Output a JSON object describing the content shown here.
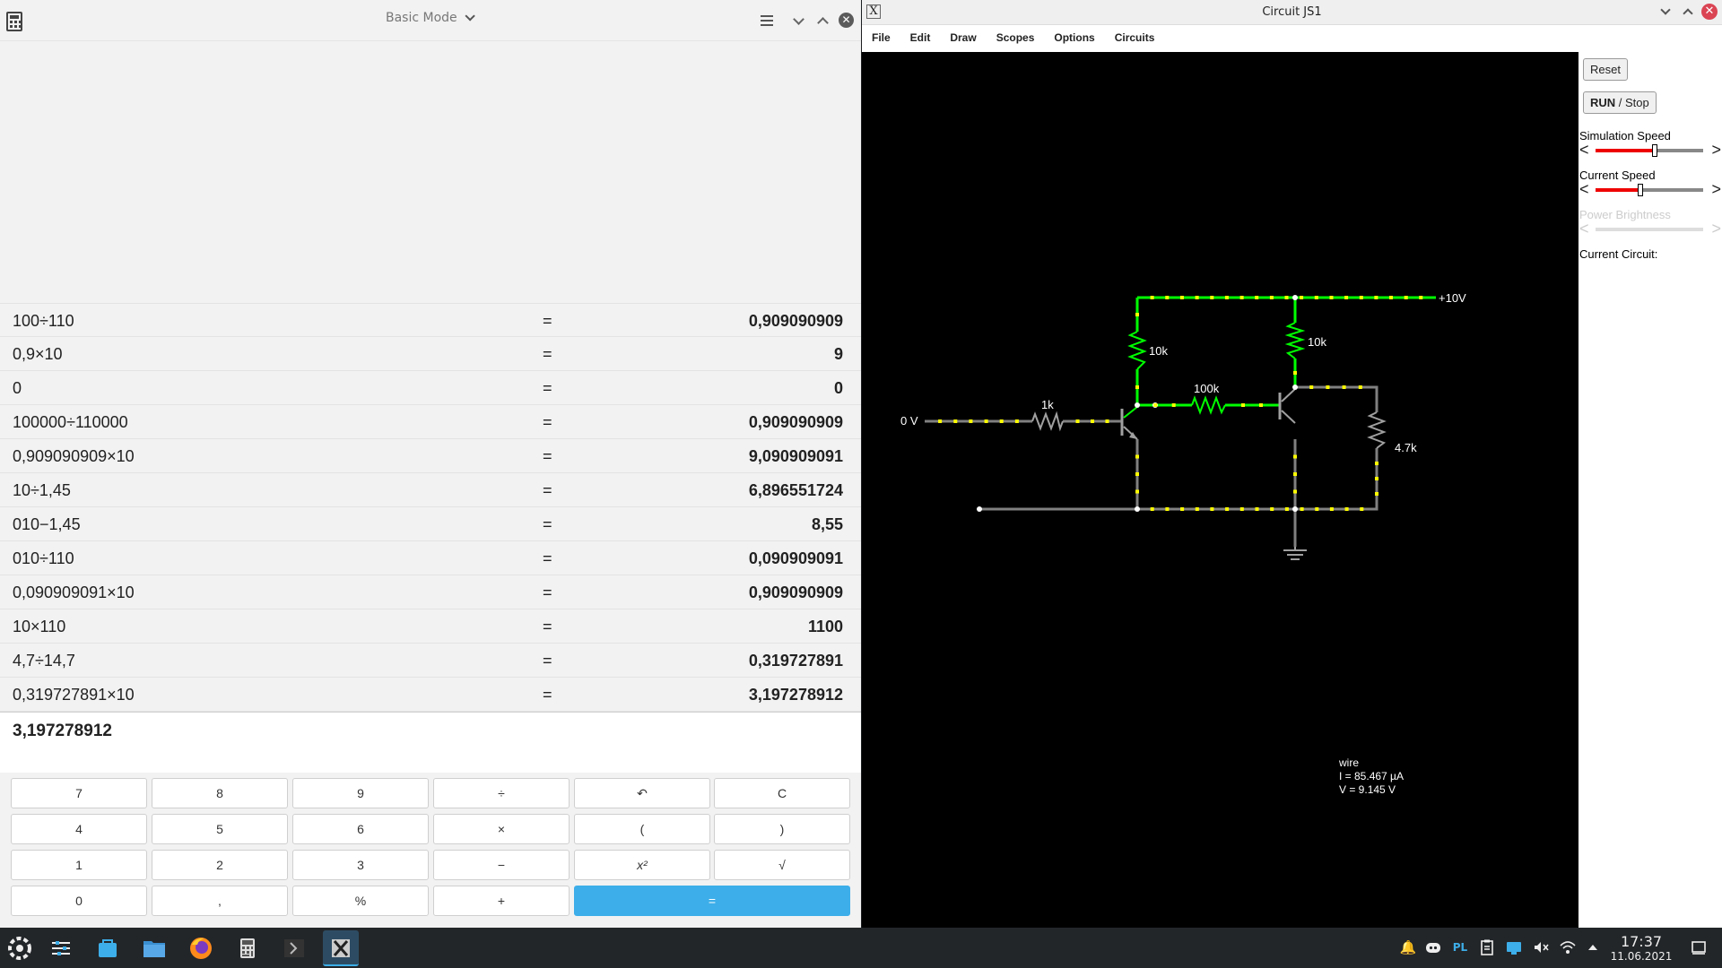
{
  "calculator": {
    "mode": "Basic Mode",
    "history": [
      {
        "expr": "100÷110",
        "eq": "=",
        "result": "0,909090909"
      },
      {
        "expr": "0,9×10",
        "eq": "=",
        "result": "9"
      },
      {
        "expr": "0",
        "eq": "=",
        "result": "0"
      },
      {
        "expr": "100000÷110000",
        "eq": "=",
        "result": "0,909090909"
      },
      {
        "expr": "0,909090909×10",
        "eq": "=",
        "result": "9,090909091"
      },
      {
        "expr": "10÷1,45",
        "eq": "=",
        "result": "6,896551724"
      },
      {
        "expr": "010−1,45",
        "eq": "=",
        "result": "8,55"
      },
      {
        "expr": "010÷110",
        "eq": "=",
        "result": "0,090909091"
      },
      {
        "expr": "0,090909091×10",
        "eq": "=",
        "result": "0,909090909"
      },
      {
        "expr": "10×110",
        "eq": "=",
        "result": "1100"
      },
      {
        "expr": "4,7÷14,7",
        "eq": "=",
        "result": "0,319727891"
      },
      {
        "expr": "0,319727891×10",
        "eq": "=",
        "result": "3,197278912"
      }
    ],
    "display": "3,197278912",
    "keys": {
      "k7": "7",
      "k8": "8",
      "k9": "9",
      "div": "÷",
      "undo": "↶",
      "clear": "C",
      "k4": "4",
      "k5": "5",
      "k6": "6",
      "mul": "×",
      "lparen": "(",
      "rparen": ")",
      "k1": "1",
      "k2": "2",
      "k3": "3",
      "sub": "−",
      "square": "x²",
      "sqrt": "√",
      "k0": "0",
      "comma": ",",
      "percent": "%",
      "add": "+",
      "equals": "="
    }
  },
  "circuitjs": {
    "title": "Circuit JS1",
    "menu": [
      "File",
      "Edit",
      "Draw",
      "Scopes",
      "Options",
      "Circuits"
    ],
    "reset": "Reset",
    "run_bold": "RUN",
    "run_rest": " / Stop",
    "sim_speed_label": "Simulation Speed",
    "current_speed_label": "Current Speed",
    "power_brightness_label": "Power Brightness",
    "current_circuit_label": "Current Circuit:",
    "sim_speed_level": 0.55,
    "current_speed_level": 0.42,
    "labels": {
      "input": "0 V",
      "r_base": "1k",
      "r_col1": "10k",
      "r_col2": "10k",
      "r_feedback": "100k",
      "r_out": "4.7k",
      "supply": "+10V"
    },
    "info": {
      "line1": "wire",
      "line2": "I = 85.467 µA",
      "line3": "V = 9.145 V"
    }
  },
  "taskbar": {
    "time": "17:37",
    "date": "11.06.2021",
    "lang": "PL"
  },
  "colors": {
    "accent": "#3daee9",
    "close": "#da4453",
    "wire_active": "#00ff00",
    "wire_idle": "#808080",
    "dots": "#ffff00"
  }
}
